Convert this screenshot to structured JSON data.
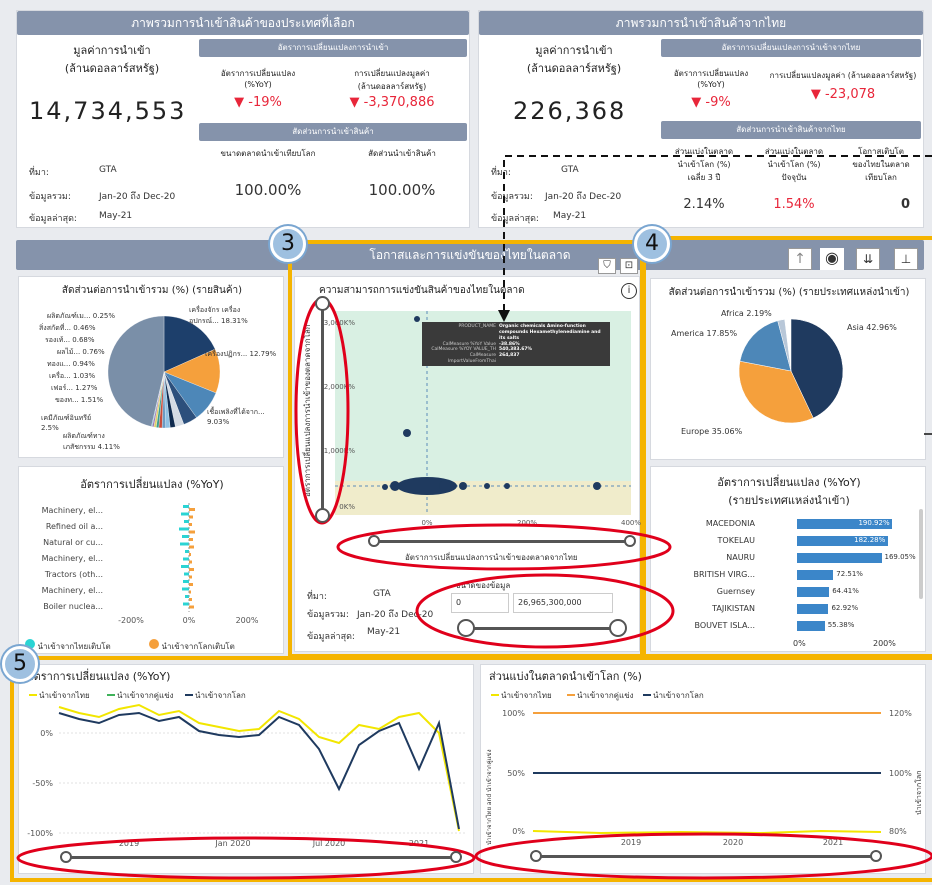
{
  "left_panel": {
    "banner": "ภาพรวมการนำเข้าสินค้าของประเทศที่เลือก",
    "import_value_label": "มูลค่าการนำเข้า\n(ล้านดอลลาร์สหรัฐ)",
    "import_value": "14,734,553",
    "rate_banner": "อัตราการเปลี่ยนแปลงการนำเข้า",
    "yoy_label": "อัตราการเปลี่ยนแปลง\n(%YoY)",
    "yoy_value": "▼ -19%",
    "change_label": "การเปลี่ยนแปลงมูลค่า\n(ล้านดอลลาร์สหรัฐ)",
    "change_value": "▼ -3,370,886",
    "share_banner": "สัดส่วนการนำเข้าสินค้า",
    "world_market_label": "ขนาดตลาดนำเข้าเทียบโลก",
    "world_market_value": "100.00%",
    "product_share_label": "สัดส่วนนำเข้าสินค้า",
    "product_share_value": "100.00%",
    "source_label": "ที่มา:",
    "source_value": "GTA",
    "coverage_label": "ข้อมูลรวม:",
    "coverage_value": "Jan-20 ถึง Dec-20",
    "latest_label": "ข้อมูลล่าสุด:",
    "latest_value": "May-21"
  },
  "right_panel": {
    "banner": "ภาพรวมการนำเข้าสินค้าจากไทย",
    "import_value_label": "มูลค่าการนำเข้า\n(ล้านดอลลาร์สหรัฐ)",
    "import_value": "226,368",
    "rate_banner": "อัตราการเปลี่ยนแปลงการนำเข้าจากไทย",
    "yoy_label": "อัตราการเปลี่ยนแปลง\n(%YoY)",
    "yoy_value": "▼ -9%",
    "change_label": "การเปลี่ยนแปลงมูลค่า (ล้านดอลลาร์สหรัฐ)",
    "change_value": "▼ -23,078",
    "share_banner": "สัดส่วนการนำเข้าสินค้าจากไทย",
    "share3y_label": "ส่วนแบ่งในตลาด\nนำเข้าโลก (%)\nเฉลี่ย 3 ปี",
    "share3y_value": "2.14%",
    "sharenow_label": "ส่วนแบ่งในตลาด\nนำเข้าโลก (%)\nปัจจุบัน",
    "sharenow_value": "1.54%",
    "opp_label": "โอกาสเติบโต\nของไทยในตลาด\nเทียบโลก",
    "opp_value": "0",
    "source_label": "ที่มา:",
    "source_value": "GTA",
    "coverage_label": "ข้อมูลรวม:",
    "coverage_value": "Jan-20 ถึง Dec-20",
    "latest_label": "ข้อมูลล่าสุด:",
    "latest_value": "May-21"
  },
  "middle_banner": "โอกาสและการแข่งขันของไทยในตลาด",
  "callouts": [
    "3",
    "4",
    "5"
  ],
  "pie_left": {
    "title": "สัดส่วนต่อการนำเข้ารวม (%) (รายสินค้า)",
    "labels": [
      "ผลิตภัณฑ์เม... 0.25%",
      "สิ่งสกัดที่... 0.46%",
      "รองเท้... 0.68%",
      "ผลไม้... 0.76%",
      "ทองแ... 0.94%",
      "เครื่อ... 1.03%",
      "เฟอร์... 1.27%",
      "ของท... 1.51%",
      "เคมีภัณฑ์อินทรีย์ 2.5%",
      "ผลิตภัณฑ์ทางเภสัชกรรม 4.11%",
      "เครื่องจักร เครื่องอุปกรณ์... 18.31%",
      "เครื่องปฏิกร... 12.79%",
      "เชื้อเพลิงที่ได้จาก... 9.03%"
    ]
  },
  "yoy_left": {
    "title": "อัตราการเปลี่ยนแปลง (%YoY)",
    "categories": [
      "Machinery, el...",
      "Refined oil a...",
      "Natural or cu...",
      "Machinery, el...",
      "Tractors (oth...",
      "Machinery, el...",
      "Boiler nuclea..."
    ],
    "ticks": [
      "-200%",
      "0%",
      "200%"
    ],
    "legend": [
      "นำเข้าจากไทยเติบโต",
      "นำเข้าจากโลกเติบโต"
    ]
  },
  "scatter": {
    "title": "ความสามารถการแข่งขันสินค้าของไทยในตลาด",
    "yticks": [
      "3,000K%",
      "2,000K%",
      "1,000K%",
      "0K%"
    ],
    "xticks": [
      "0%",
      "200%",
      "400%"
    ],
    "ylabel": "อัตราการเปลี่ยนแปลงการนำเข้าของตลาดจากโลก",
    "xlabel": "อัตราการเปลี่ยนแปลงการนำเข้าของตลาดจากไทย",
    "tooltip": [
      [
        "PRODUCT_NAME",
        "Organic chemicals Amino-function compounds Hexamethylenediamine and its salts"
      ],
      [
        "CalMeasure %YoY Value",
        "-38.86%"
      ],
      [
        "CalMeasure %YOY VALUE_TH",
        "540,383.67%"
      ],
      [
        "CalMeasure ImportValueFromThai",
        "264,837"
      ]
    ],
    "source_label": "ที่มา:",
    "source_value": "GTA",
    "coverage_label": "ข้อมูลรวม:",
    "coverage_value": "Jan-20 ถึง Dec-20",
    "latest_label": "ข้อมูลล่าสุด:",
    "latest_value": "May-21",
    "range_label": "ขนาดของข้อมูล",
    "range_min": "0",
    "range_max": "26,965,300,000"
  },
  "pie_right": {
    "title": "สัดส่วนต่อการนำเข้ารวม (%) (รายประเทศแหล่งนำเข้า)",
    "labels": [
      "Africa 2.19%",
      "America 17.85%",
      "Asia 42.96%",
      "Europe 35.06%"
    ]
  },
  "yoy_right": {
    "title": "อัตราการเปลี่ยนแปลง (%YoY)\n(รายประเทศแหล่งนำเข้า)",
    "rows": [
      {
        "name": "MACEDONIA",
        "value": "190.92%",
        "pct": 190.92
      },
      {
        "name": "TOKELAU",
        "value": "182.28%",
        "pct": 182.28
      },
      {
        "name": "NAURU",
        "value": "169.05%",
        "pct": 169.05
      },
      {
        "name": "BRITISH VIRG...",
        "value": "72.51%",
        "pct": 72.51
      },
      {
        "name": "Guernsey",
        "value": "64.41%",
        "pct": 64.41
      },
      {
        "name": "TAJIKISTAN",
        "value": "62.92%",
        "pct": 62.92
      },
      {
        "name": "BOUVET ISLA...",
        "value": "55.38%",
        "pct": 55.38
      }
    ],
    "ticks": [
      "0%",
      "200%"
    ]
  },
  "line_left": {
    "title": "อัตราการเปลี่ยนแปลง (%YoY)",
    "legend": [
      "นำเข้าจากไทย",
      "นำเข้าจากคู่แข่ง",
      "นำเข้าจากโลก"
    ],
    "yticks": [
      "0%",
      "-50%",
      "-100%"
    ],
    "xticks": [
      "2019",
      "Jan 2020",
      "Jul 2020",
      "2021"
    ]
  },
  "line_right": {
    "title": "ส่วนแบ่งในตลาดนำเข้าโลก (%)",
    "legend": [
      "นำเข้าจากไทย",
      "นำเข้าจากคู่แข่ง",
      "นำเข้าจากโลก"
    ],
    "yticks_left": [
      "100%",
      "50%",
      "0%"
    ],
    "yticks_right": [
      "120%",
      "100%",
      "80%"
    ],
    "xticks": [
      "2019",
      "2020",
      "2021"
    ],
    "ylabel_left": "นำเข้าจากไทย and นำเข้าจากคู่แข่ง",
    "ylabel_right": "นำเข้าจากโลก"
  },
  "colors": {
    "thai": "#f2e600",
    "competitor": "#f5a03c",
    "world": "#1f3a5f",
    "teal": "#2ad4d4",
    "orange": "#f5a03c",
    "banner": "#8593ab",
    "gold": "#f5b400",
    "red": "#e0001b"
  }
}
